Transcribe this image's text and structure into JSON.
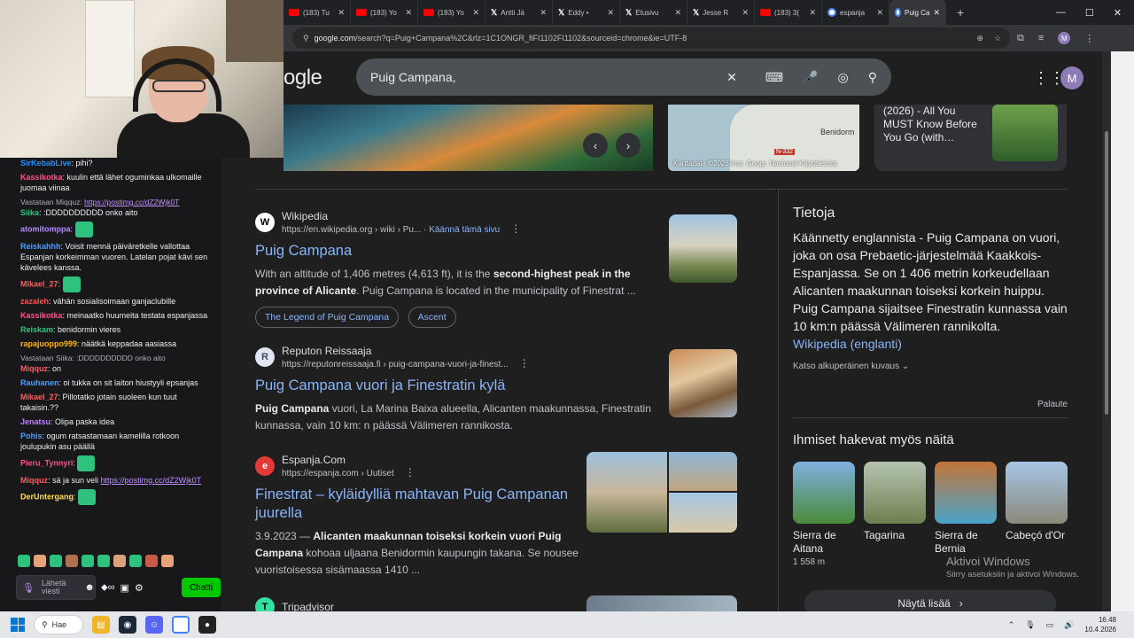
{
  "chat": {
    "messages": [
      {
        "user": "SirKebabLive",
        "color": "#1e90ff",
        "text": "pihi?"
      },
      {
        "user": "Kassikotka",
        "color": "#ff4f8b",
        "text": "kuulin että lähet oguminkaa ulkomaille juomaa viinaa"
      },
      {
        "reply": "Vastataan Miqquz: https://postimg.cc/dZ2Wjk0T",
        "user": "Siika",
        "color": "#2ec27e",
        "text": ":DDDDDDDDDD onko aito"
      },
      {
        "user": "atomitomppa",
        "color": "#b48aff",
        "text": ""
      },
      {
        "user": "Reiskahhh",
        "color": "#4a9eff",
        "text": "Voisit mennä päiväretkelle vallottaa Espanjan korkeimman vuoren. Latelan pojat kävi sen kävelees kanssa."
      },
      {
        "user": "Mikael_27",
        "color": "#ff5c5c",
        "text": ""
      },
      {
        "user": "zazaleh",
        "color": "#ff4f4f",
        "text": "vähän sosialisoimaan ganjaclubille"
      },
      {
        "user": "Kassikotka",
        "color": "#ff4f8b",
        "text": "meinaatko huumeita testata espanjassa"
      },
      {
        "user": "Reiskam",
        "color": "#2ec27e",
        "text": "benidormin vieres"
      },
      {
        "user": "rapajuoppo999",
        "color": "#ffb400",
        "text": "näätkä keppadaa aasiassa"
      },
      {
        "reply": "Vastataan Siika: :DDDDDDDDDD onko aito",
        "user": "Miqquz",
        "color": "#ff5c5c",
        "text": "on"
      },
      {
        "user": "Rauhanen",
        "color": "#4a9eff",
        "text": "oi tukka on sit laiton hiustyyli epsanjas"
      },
      {
        "user": "Mikael_27",
        "color": "#ff5c5c",
        "text": "Pillotatko jotain suoleen kun tuut takaisin.??"
      },
      {
        "user": "Jenatsu",
        "color": "#c080ff",
        "text": "Olipa paska idea"
      },
      {
        "user": "Pohis",
        "color": "#4a9eff",
        "text": "ogum ratsastamaan kamelilla rotkoon joulupukin asu päällä"
      },
      {
        "user": "Pieru_Tynnyri",
        "color": "#ff4f8b",
        "text": ""
      },
      {
        "user": "Miqquz",
        "color": "#ff5c5c",
        "text": "sä ja sun veli https://postimg.cc/dZ2Wjk0T"
      },
      {
        "user": "DerUntergang",
        "color": "#ffe14d",
        "text": ""
      }
    ],
    "input_placeholder": "Lähetä viesti",
    "send_label": "Chatti"
  },
  "browser": {
    "tabs": [
      {
        "icon": "youtube",
        "label": "(183) Tu"
      },
      {
        "icon": "youtube",
        "label": "(183) Yo"
      },
      {
        "icon": "youtube",
        "label": "(183) Yo"
      },
      {
        "icon": "x",
        "label": "Antti Jä"
      },
      {
        "icon": "x",
        "label": "Eddy •"
      },
      {
        "icon": "x",
        "label": "Etusivu"
      },
      {
        "icon": "x",
        "label": "Jesse R"
      },
      {
        "icon": "youtube",
        "label": "(183) 3("
      },
      {
        "icon": "google",
        "label": "espanja"
      },
      {
        "icon": "google",
        "label": "Puig Ca",
        "active": true
      }
    ],
    "url_domain": "google.com",
    "url_path": "/search?q=Puig+Campana%2C&rlz=1C1ONGR_fiFI1102FI1102&sourceid=chrome&ie=UTF-8",
    "profile_initial": "M"
  },
  "google": {
    "logo_text": "ogle",
    "query": "Puig Campana,",
    "account_initial": "M",
    "map": {
      "city": "Benidorm",
      "road": "N-332",
      "attribution": "Karttadata ©2026 Inst. Geogr. Nacional   Käyttöehdot"
    },
    "top_card": "(2026) - All You MUST Know Before You Go (with…",
    "results": [
      {
        "favicon": "W",
        "source": "Wikipedia",
        "url": "https://en.wikipedia.org › wiki › Pu...",
        "translate": "Käännä tämä sivu",
        "title": "Puig Campana",
        "snippet_pre": "With an altitude of 1,406 metres (4,613 ft), it is the ",
        "snippet_bold": "second-highest peak in the province of Alicante",
        "snippet_post": ". Puig Campana is located in the municipality of Finestrat ...",
        "chips": [
          "The Legend of Puig Campana",
          "Ascent"
        ]
      },
      {
        "favicon": "R",
        "source": "Reputon Reissaaja",
        "url": "https://reputonreissaaja.fi › puig-campana-vuori-ja-finest...",
        "title": "Puig Campana vuori ja Finestratin kylä",
        "snippet_bold": "Puig Campana",
        "snippet_post": " vuori, La Marina Baixa alueella, Alicanten maakunnassa, Finestratin kunnassa, vain 10 km: n päässä Välimeren rannikosta."
      },
      {
        "favicon": "e",
        "source": "Espanja.Com",
        "url": "https://espanja.com › Uutiset",
        "title": "Finestrat – kyläidylliä mahtavan Puig Campanan juurella",
        "date": "3.9.2023 — ",
        "snippet_bold": "Alicanten maakunnan toiseksi korkein vuori Puig Campana",
        "snippet_post": " kohoaa uljaana Benidormin kaupungin takana. Se nousee vuoristoisessa sisämaassa 1410 ..."
      },
      {
        "favicon": "T",
        "source": "Tripadvisor"
      }
    ],
    "knowledge_panel": {
      "title": "Tietoja",
      "text": "Käännetty englannista - Puig Campana on vuori, joka on osa Prebaetic-järjestelmää Kaakkois-Espanjassa. Se on 1 406 metrin korkeudellaan Alicanten maakunnan toiseksi korkein huippu. Puig Campana sijaitsee Finestratin kunnassa vain 10 km:n päässä Välimeren rannikolta.",
      "link": "Wikipedia (englanti)",
      "original": "Katso alkuperäinen kuvaus",
      "feedback": "Palaute",
      "pasf_title": "Ihmiset hakevat myös näitä",
      "pasf": [
        {
          "label": "Sierra de Aitana",
          "sub": "1 558 m"
        },
        {
          "label": "Tagarina",
          "sub": ""
        },
        {
          "label": "Sierra de Bernia",
          "sub": ""
        },
        {
          "label": "Cabeçó d'Or",
          "sub": ""
        }
      ],
      "more": "Näytä lisää"
    },
    "activate": {
      "line1": "Aktivoi Windows",
      "line2": "Siirry asetuksiin ja aktivoi Windows."
    }
  },
  "taskbar": {
    "search": "Hae",
    "time": "16.48",
    "date": "10.4.2026"
  }
}
